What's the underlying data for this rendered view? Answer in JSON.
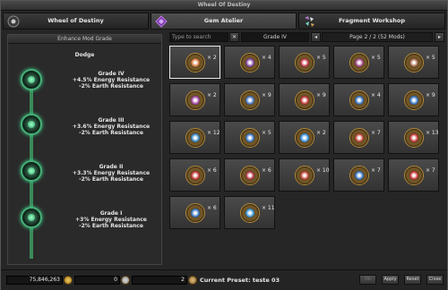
{
  "window": {
    "title": "Wheel Of Destiny"
  },
  "tabs": [
    {
      "label": "Wheel of Destiny",
      "icon": "eye-wheel-icon"
    },
    {
      "label": "Gem Atelier",
      "icon": "purple-gem-icon"
    },
    {
      "label": "Fragment Workshop",
      "icon": "fragments-icon"
    }
  ],
  "left_panel": {
    "header": "Enhance Mod Grade",
    "subject": "Dodge",
    "grades": [
      {
        "title": "Grade IV",
        "line1": "+4.5% Energy Resistance",
        "line2": "-2% Earth Resistance"
      },
      {
        "title": "Grade III",
        "line1": "+3.6% Energy Resistance",
        "line2": "-2% Earth Resistance"
      },
      {
        "title": "Grade II",
        "line1": "+3.3% Energy Resistance",
        "line2": "-2% Earth Resistance"
      },
      {
        "title": "Grade I",
        "line1": "+3% Energy Resistance",
        "line2": "-2% Earth Resistance"
      }
    ]
  },
  "toolbar": {
    "search_placeholder": "Type to search",
    "clear": "✕",
    "grade_filter": "Grade IV",
    "prev": "◂",
    "page_info": "Page 2 / 2 (52 Mods)",
    "next": "▸"
  },
  "mods": [
    {
      "qty": "× 2",
      "color": "#d07030"
    },
    {
      "qty": "× 4",
      "color": "#8040a0"
    },
    {
      "qty": "× 5",
      "color": "#c03040"
    },
    {
      "qty": "× 5",
      "color": "#a04080"
    },
    {
      "qty": "× 5",
      "color": "#a06040"
    },
    {
      "qty": "× 2",
      "color": "#a040a0"
    },
    {
      "qty": "× 9",
      "color": "#4070c0"
    },
    {
      "qty": "× 9",
      "color": "#c03030"
    },
    {
      "qty": "× 4",
      "color": "#3070c0"
    },
    {
      "qty": "× 9",
      "color": "#3070c0"
    },
    {
      "qty": "× 12",
      "color": "#3080c0"
    },
    {
      "qty": "× 5",
      "color": "#3070c0"
    },
    {
      "qty": "× 2",
      "color": "#3090e0"
    },
    {
      "qty": "× 7",
      "color": "#c04030"
    },
    {
      "qty": "× 13",
      "color": "#c03030"
    },
    {
      "qty": "× 6",
      "color": "#c03030"
    },
    {
      "qty": "× 6",
      "color": "#b03040"
    },
    {
      "qty": "× 10",
      "color": "#c04030"
    },
    {
      "qty": "× 7",
      "color": "#3070c0"
    },
    {
      "qty": "× 7",
      "color": "#c03030"
    },
    {
      "qty": "× 6",
      "color": "#3070c0"
    },
    {
      "qty": "× 11",
      "color": "#3090d0"
    }
  ],
  "bottom": {
    "gold": "75,846,263",
    "field2": "0",
    "field3": "2",
    "preset": "Current Preset: teste 03",
    "buttons": [
      "Ok",
      "Apply",
      "Reset",
      "Close"
    ]
  }
}
